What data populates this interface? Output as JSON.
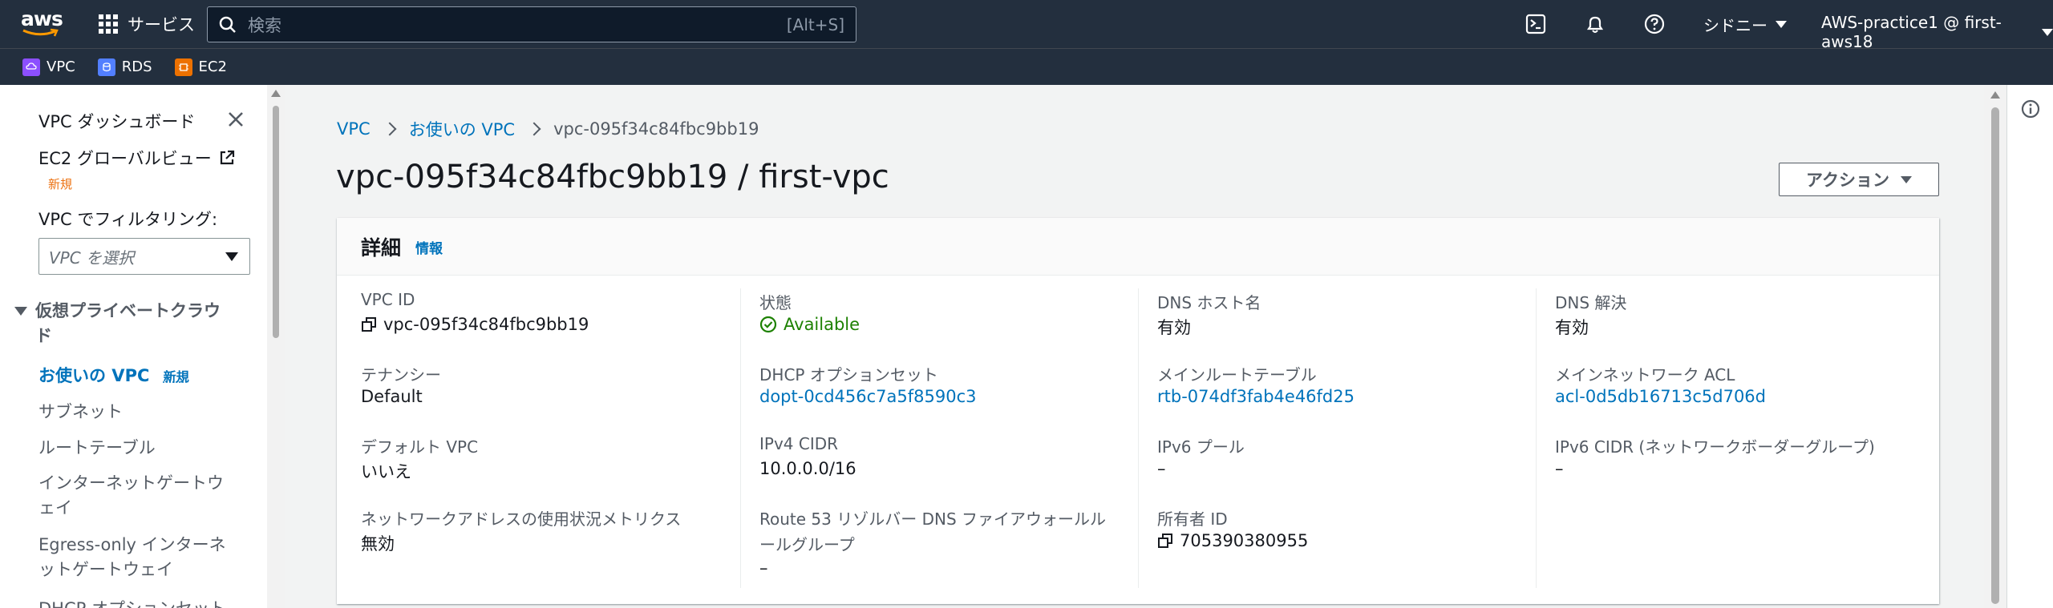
{
  "topnav": {
    "logo_text": "aws",
    "services_label": "サービス",
    "search_placeholder": "検索",
    "search_shortcut": "[Alt+S]",
    "region_label": "シドニー",
    "account_label": "AWS-practice1 @ first-aws18",
    "icons": [
      "cloudshell-icon",
      "bell-icon",
      "help-icon"
    ]
  },
  "favorites": [
    {
      "label": "VPC",
      "color": "#8c4fff"
    },
    {
      "label": "RDS",
      "color": "#527fff"
    },
    {
      "label": "EC2",
      "color": "#ed7100"
    }
  ],
  "sidebar": {
    "dashboard": "VPC ダッシュボード",
    "global_view": "EC2 グローバルビュー",
    "global_view_new": "新規",
    "filter_label": "VPC でフィルタリング:",
    "filter_placeholder": "VPC を選択",
    "section_title": "仮想プライベートクラウド",
    "items": [
      {
        "label": "お使いの VPC",
        "new": "新規"
      },
      {
        "label": "サブネット"
      },
      {
        "label": "ルートテーブル"
      },
      {
        "label_line1": "インターネットゲートウ",
        "label_line2": "ェイ"
      },
      {
        "label_line1": "Egress-only インターネ",
        "label_line2": "ットゲートウェイ"
      },
      {
        "label": "DHCP オプションセット"
      }
    ]
  },
  "breadcrumb": {
    "root": "VPC",
    "parent": "お使いの VPC",
    "current": "vpc-095f34c84fbc9bb19"
  },
  "page": {
    "title": "vpc-095f34c84fbc9bb19 / first-vpc",
    "action_label": "アクション"
  },
  "details": {
    "title": "詳細",
    "info_link": "情報",
    "col1": [
      {
        "label": "VPC ID",
        "value": "vpc-095f34c84fbc9bb19"
      },
      {
        "label": "テナンシー",
        "value": "Default"
      },
      {
        "label": "デフォルト VPC",
        "value": "いいえ"
      },
      {
        "label": "ネットワークアドレスの使用状況メトリクス",
        "value": "無効"
      }
    ],
    "col2": [
      {
        "label": "状態",
        "value": "Available"
      },
      {
        "label": "DHCP オプションセット",
        "value": "dopt-0cd456c7a5f8590c3"
      },
      {
        "label": "IPv4 CIDR",
        "value": "10.0.0.0/16"
      },
      {
        "label_line1": "Route 53 リゾルバー DNS ファイアウォールル",
        "label_line2": "ールグループ",
        "value": "–"
      }
    ],
    "col3": [
      {
        "label": "DNS ホスト名",
        "value": "有効"
      },
      {
        "label": "メインルートテーブル",
        "value": "rtb-074df3fab4e46fd25"
      },
      {
        "label": "IPv6 プール",
        "value": "–"
      },
      {
        "label": "所有者 ID",
        "value": "705390380955"
      }
    ],
    "col4": [
      {
        "label": "DNS 解決",
        "value": "有効"
      },
      {
        "label": "メインネットワーク ACL",
        "value": "acl-0d5db16713c5d706d"
      },
      {
        "label": "IPv6 CIDR (ネットワークボーダーグループ)",
        "value": "–"
      }
    ]
  },
  "colors": {
    "nav_bg": "#232f3e",
    "link": "#0073bb",
    "success": "#1d8102",
    "new_tag": "#ec7211"
  }
}
